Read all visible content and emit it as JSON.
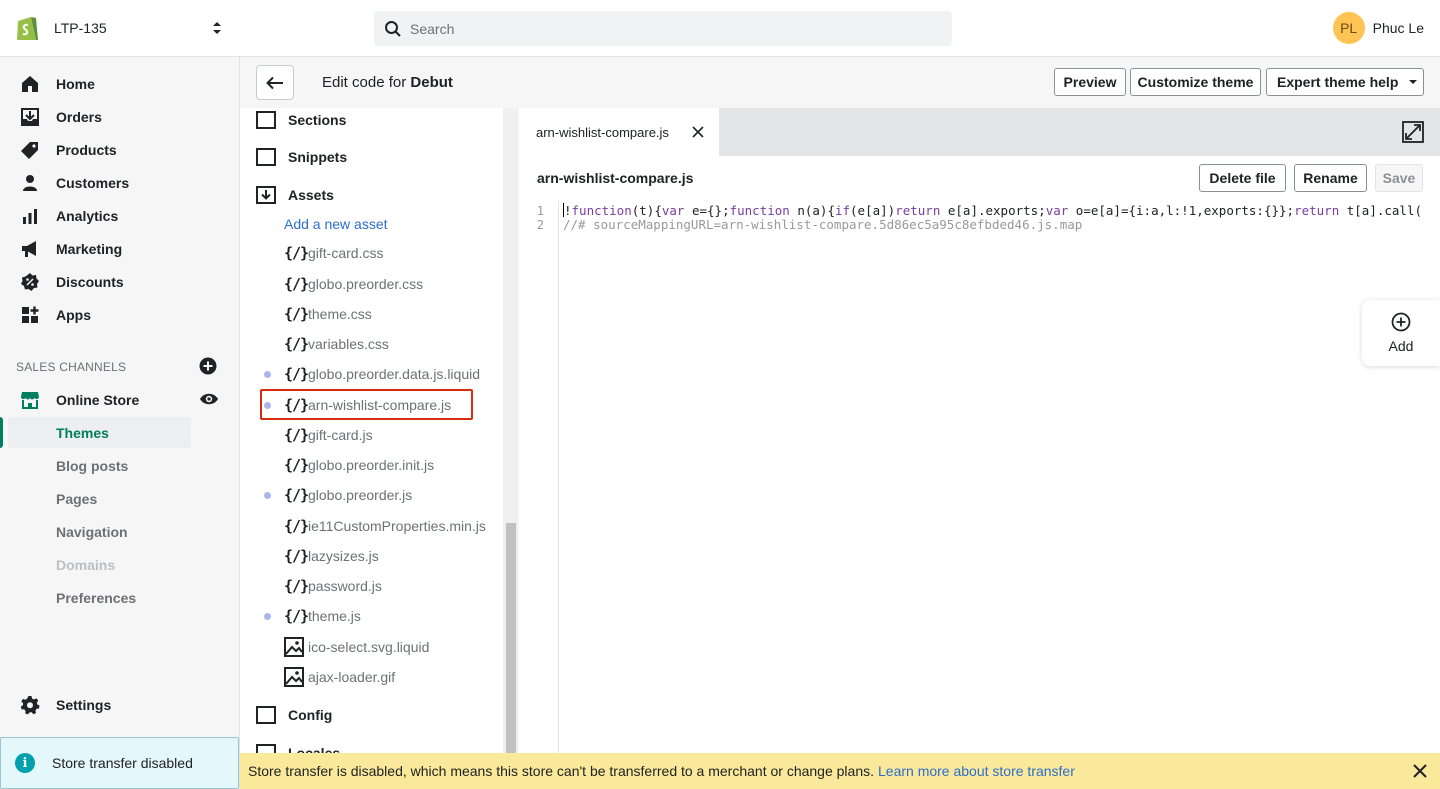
{
  "topbar": {
    "store_name": "LTP-135",
    "search_placeholder": "Search",
    "user_initials": "PL",
    "user_name": "Phuc Le"
  },
  "sidebar": {
    "items": [
      {
        "label": "Home",
        "icon": "home-icon"
      },
      {
        "label": "Orders",
        "icon": "orders-icon"
      },
      {
        "label": "Products",
        "icon": "tag-icon"
      },
      {
        "label": "Customers",
        "icon": "person-icon"
      },
      {
        "label": "Analytics",
        "icon": "bar-chart-icon"
      },
      {
        "label": "Marketing",
        "icon": "megaphone-icon"
      },
      {
        "label": "Discounts",
        "icon": "discount-icon"
      },
      {
        "label": "Apps",
        "icon": "apps-icon"
      }
    ],
    "sales_channels_header": "SALES CHANNELS",
    "online_store": "Online Store",
    "sub_items": [
      {
        "label": "Themes",
        "active": true
      },
      {
        "label": "Blog posts"
      },
      {
        "label": "Pages"
      },
      {
        "label": "Navigation"
      },
      {
        "label": "Domains",
        "disabled": true
      },
      {
        "label": "Preferences"
      }
    ],
    "settings": "Settings",
    "transfer_notice": "Store transfer disabled"
  },
  "header": {
    "title_prefix": "Edit code for",
    "theme_name": "Debut",
    "preview": "Preview",
    "customize": "Customize theme",
    "expert_help": "Expert theme help"
  },
  "tree": {
    "folders": {
      "sections": "Sections",
      "snippets": "Snippets",
      "assets": "Assets",
      "config": "Config",
      "locales": "Locales"
    },
    "add_asset": "Add a new asset",
    "files": [
      {
        "name": "gift-card.css",
        "type": "code"
      },
      {
        "name": "globo.preorder.css",
        "type": "code"
      },
      {
        "name": "theme.css",
        "type": "code"
      },
      {
        "name": "variables.css",
        "type": "code"
      },
      {
        "name": "globo.preorder.data.js.liquid",
        "type": "code",
        "modified": true
      },
      {
        "name": "arn-wishlist-compare.js",
        "type": "code",
        "modified": true,
        "selected": true
      },
      {
        "name": "gift-card.js",
        "type": "code"
      },
      {
        "name": "globo.preorder.init.js",
        "type": "code"
      },
      {
        "name": "globo.preorder.js",
        "type": "code",
        "modified": true
      },
      {
        "name": "ie11CustomProperties.min.js",
        "type": "code"
      },
      {
        "name": "lazysizes.js",
        "type": "code"
      },
      {
        "name": "password.js",
        "type": "code"
      },
      {
        "name": "theme.js",
        "type": "code",
        "modified": true
      },
      {
        "name": "ico-select.svg.liquid",
        "type": "image"
      },
      {
        "name": "ajax-loader.gif",
        "type": "image"
      }
    ],
    "code_glyph": "{/}"
  },
  "editor": {
    "tab_label": "arn-wishlist-compare.js",
    "file_name": "arn-wishlist-compare.js",
    "delete": "Delete file",
    "rename": "Rename",
    "save": "Save",
    "line_numbers": [
      "1",
      "2"
    ],
    "line1": {
      "p1": "!",
      "p2": "function",
      "p3": "(t){",
      "p4": "var",
      "p5": " e={};",
      "p6": "function",
      "p7": " n(a){",
      "p8": "if",
      "p9": "(e[a])",
      "p10": "return",
      "p11": " e[a].exports;",
      "p12": "var",
      "p13": " o=e[a]={i:a,l:!1,exports:{}};",
      "p14": "return",
      "p15": " t[a].call("
    },
    "line2": "//# sourceMappingURL=arn-wishlist-compare.5d86ec5a95c8efbded46.js.map"
  },
  "add_panel": {
    "label": "Add"
  },
  "banner": {
    "text": "Store transfer is disabled, which means this store can't be transferred to a merchant or change plans.",
    "link": "Learn more about store transfer"
  },
  "colors": {
    "accent": "#008060",
    "link": "#2c6ecb",
    "banner_bg": "#fbe99b",
    "modified_dot": "#aab4f2",
    "highlight": "#d72c0d"
  }
}
